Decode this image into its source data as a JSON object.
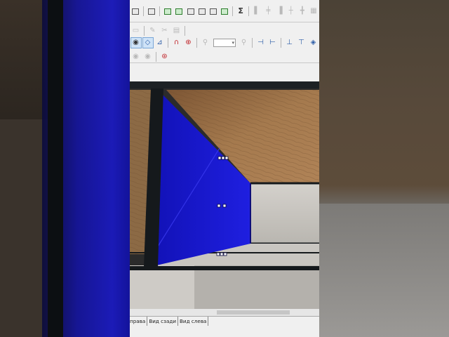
{
  "viewport_tabs": [
    "права",
    "Вид сзади",
    "Вид слева"
  ],
  "toolbar1_icons": [
    "layers-icon",
    "properties-icon",
    "table-icon",
    "copy-icon",
    "export-icon",
    "import-icon",
    "save-icon",
    "settings-icon",
    "sum-icon",
    "align-left-icon",
    "align-center-icon",
    "align-right-icon",
    "distribute-icon",
    "more-icon"
  ],
  "toolbar1_sum_glyph": "Σ",
  "toolbar3_icons": [
    "eye-icon",
    "vertex-edit-icon",
    "measure-icon",
    "magnet-icon",
    "target-icon",
    "zoom-icon",
    "snap-icon",
    "rotate-icon",
    "flip-icon",
    "mirror-icon",
    "tag-icon"
  ],
  "colors": {
    "glass_blue": "#1b1bd6",
    "frame_dark": "#14181b",
    "wood_oak": "#9a7048",
    "concrete": "#c6c3be",
    "toolbar_bg": "#f0f0f0"
  }
}
